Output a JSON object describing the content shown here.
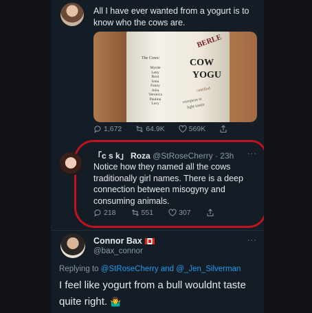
{
  "tweet1": {
    "text": "All I have ever wanted from a yogurt is to know who the cows are.",
    "image": {
      "cows_title": "The Cows:",
      "cows": [
        "Myrtle",
        "Letty",
        "Root",
        "Irma",
        "Fanny",
        "Julia",
        "Veronica",
        "Paulina",
        "Lucy"
      ],
      "brand": "BERLE",
      "big_line1": "COW",
      "big_line2": "YOGU",
      "small1": "certified",
      "small2": "european st",
      "small3": "light tastin"
    },
    "replies": "1,672",
    "retweets": "64.9K",
    "likes": "569K"
  },
  "tweet2": {
    "prefix": "「c s k」",
    "name": "Roza",
    "handle": "@StRoseCherry",
    "time": "23h",
    "more": "···",
    "text": "Notice how they named all the cows traditionally girl names. There is a deep connection between misogyny and consuming animals.",
    "replies": "218",
    "retweets": "551",
    "likes": "307"
  },
  "tweet3": {
    "name": "Connor Bax",
    "handle": "@bax_connor",
    "more": "···",
    "replying_prefix": "Replying to",
    "reply_to1": "@StRoseCherry",
    "reply_and": "and",
    "reply_to2": "@_Jen_Silverman",
    "text": "I feel like yogurt from a bull wouldnt taste quite right.",
    "emoji": "🤷‍♂️"
  },
  "colors": {
    "background": "#141d26",
    "text": "#e7e9ea",
    "muted": "#8899a6",
    "link": "#1d9bf0",
    "highlight": "#c1121f"
  }
}
